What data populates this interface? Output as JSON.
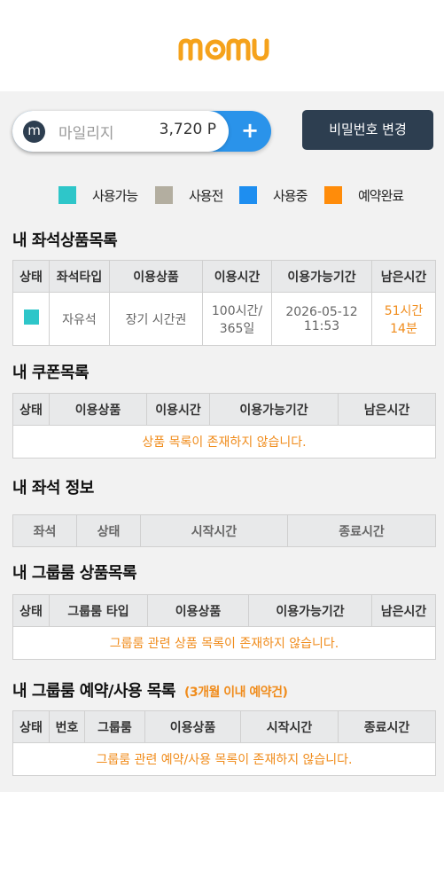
{
  "colors": {
    "available": "#2ec6c9",
    "before_use": "#b3aea0",
    "in_use": "#1e8ef0",
    "reserved": "#ff8c0a",
    "accent_orange": "#f08c1c",
    "dark_navy": "#2d3e50",
    "brand_blue": "#2a93ea"
  },
  "logo": {
    "text": "momu"
  },
  "mileage": {
    "badge": "m",
    "label": "마일리지",
    "value": "3,720 P",
    "plus": "+"
  },
  "password_button": "비밀번호 변경",
  "legend": [
    {
      "label": "사용가능",
      "color": "#2ec6c9"
    },
    {
      "label": "사용전",
      "color": "#b3aea0"
    },
    {
      "label": "사용중",
      "color": "#1e8ef0"
    },
    {
      "label": "예약완료",
      "color": "#ff8c0a"
    }
  ],
  "seat_products": {
    "title": "내 좌석상품목록",
    "headers": [
      "상태",
      "좌석타입",
      "이용상품",
      "이용시간",
      "이용가능기간",
      "남은시간"
    ],
    "rows": [
      {
        "seat_type": "자유석",
        "product": "장기 시간권",
        "time_line1": "100시간/",
        "time_line2": "365일",
        "period_line1": "2026-05-12",
        "period_line2": "11:53",
        "remain_line1": "51시간",
        "remain_line2": "14분"
      }
    ]
  },
  "coupons": {
    "title": "내 쿠폰목록",
    "headers": [
      "상태",
      "이용상품",
      "이용시간",
      "이용가능기간",
      "남은시간"
    ],
    "empty": "상품 목록이 존재하지 않습니다."
  },
  "seat_info": {
    "title": "내 좌석 정보",
    "headers": [
      "좌석",
      "상태",
      "시작시간",
      "종료시간"
    ]
  },
  "group_products": {
    "title": "내 그룹룸 상품목록",
    "headers": [
      "상태",
      "그룹룸 타입",
      "이용상품",
      "이용가능기간",
      "남은시간"
    ],
    "empty": "그룹룸 관련 상품 목록이 존재하지 않습니다."
  },
  "group_reservations": {
    "title": "내 그룹룸 예약/사용 목록",
    "subtitle": "(3개월 이내 예약건)",
    "headers": [
      "상태",
      "번호",
      "그룹룸",
      "이용상품",
      "시작시간",
      "종료시간"
    ],
    "empty": "그룹룸 관련 예약/사용 목록이 존재하지 않습니다."
  }
}
